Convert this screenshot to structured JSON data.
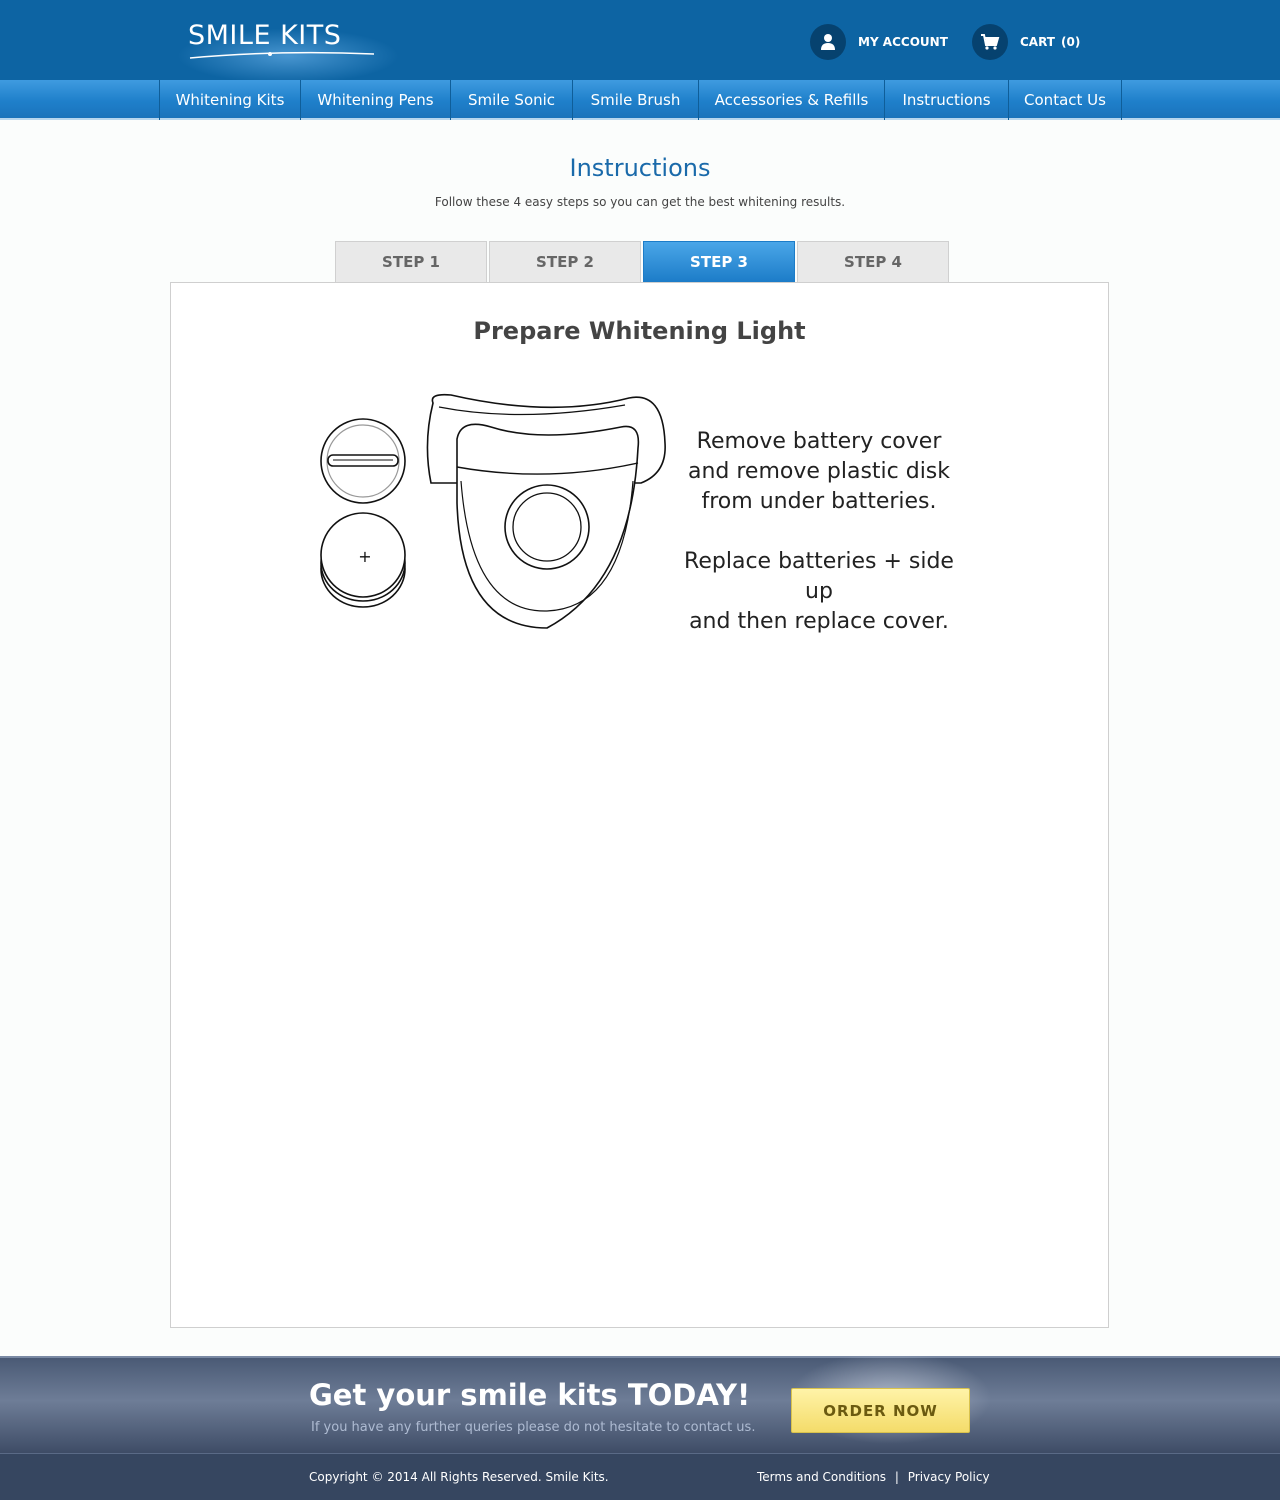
{
  "header": {
    "logo_text": "SMILE KITS",
    "account_label": "MY ACCOUNT",
    "cart_label": "CART",
    "cart_count": "(0)"
  },
  "nav": {
    "items": [
      {
        "label": "Whitening Kits"
      },
      {
        "label": "Whitening Pens"
      },
      {
        "label": "Smile Sonic"
      },
      {
        "label": "Smile Brush"
      },
      {
        "label": "Accessories & Refills"
      },
      {
        "label": "Instructions"
      },
      {
        "label": "Contact Us"
      }
    ]
  },
  "main": {
    "title": "Instructions",
    "subtitle": "Follow these 4 easy steps so you can get the best whitening results.",
    "tabs": [
      {
        "label": "STEP 1",
        "active": false
      },
      {
        "label": "STEP 2",
        "active": false
      },
      {
        "label": "STEP 3",
        "active": true
      },
      {
        "label": "STEP 4",
        "active": false
      }
    ],
    "step": {
      "title": "Prepare Whitening Light",
      "plus_symbol": "+",
      "instructions": [
        "Remove battery cover",
        "and remove plastic disk",
        "from under batteries.",
        "Replace batteries + side up",
        "and then replace cover."
      ]
    }
  },
  "cta": {
    "title": "Get your smile kits TODAY!",
    "subtitle": "If you have any further queries please do not hesitate to contact us.",
    "button_label": "ORDER NOW"
  },
  "footer": {
    "copyright": "Copyright © 2014 All Rights Reserved.  Smile Kits.",
    "terms": "Terms and Conditions",
    "separator": "|",
    "privacy": "Privacy Policy"
  },
  "colors": {
    "header_bg": "#0d64a3",
    "nav_bg": "#1f80cb",
    "active_tab": "#1c7cc8",
    "cta_bg": "#4a5a75",
    "footer_bg": "#364660",
    "order_button": "#f4dc6a"
  },
  "icons": {
    "account": "user-icon",
    "cart": "cart-icon"
  }
}
